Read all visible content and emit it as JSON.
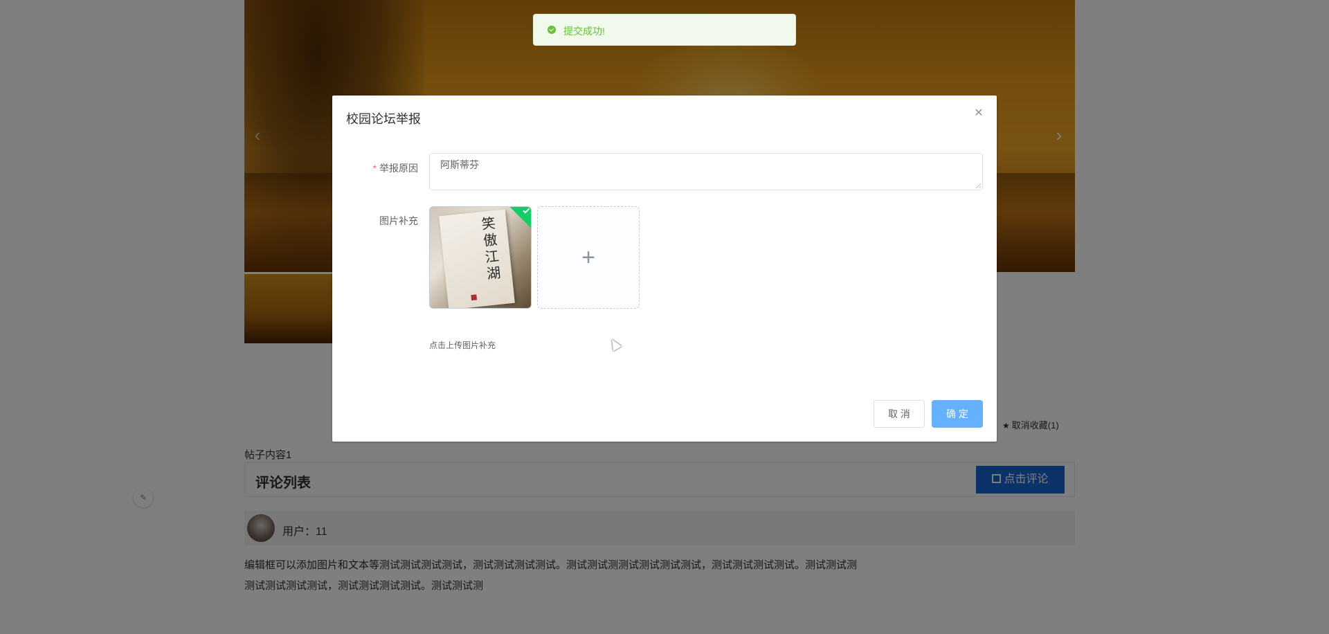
{
  "background_page": {
    "favorite_link": "取消收藏(1)",
    "post_content": "帖子内容1",
    "comment_section": {
      "title": "评论列表",
      "comment_button": "点击评论"
    },
    "comment": {
      "user_label": "用户：11",
      "text_line1": "编辑框可以添加图片和文本等测试测试测试测试，测试测试测试测试。测试测试测测试测试测试测试，测试测试测试测试。测试测试测",
      "text_line2": "测试测试测试测试，测试测试测试测试。测试测试测"
    }
  },
  "toast": {
    "message": "提交成功!"
  },
  "dialog": {
    "title": "校园论坛举报",
    "reason_label": "举报原因",
    "reason_required_mark": "*",
    "reason_value": "阿斯蒂芬",
    "images_label": "图片补充",
    "uploaded_image_text": "笑傲江湖",
    "upload_tip": "点击上传图片补充",
    "cancel_button": "取 消",
    "confirm_button": "确 定"
  },
  "icons": {
    "close": "close-icon",
    "plus": "plus-icon",
    "success": "success-check-icon",
    "star": "star-icon",
    "edit": "edit-icon"
  },
  "colors": {
    "primary": "#66b1ff",
    "success": "#67c23a",
    "comment_button": "#1866d3",
    "required": "#f56c6c"
  }
}
